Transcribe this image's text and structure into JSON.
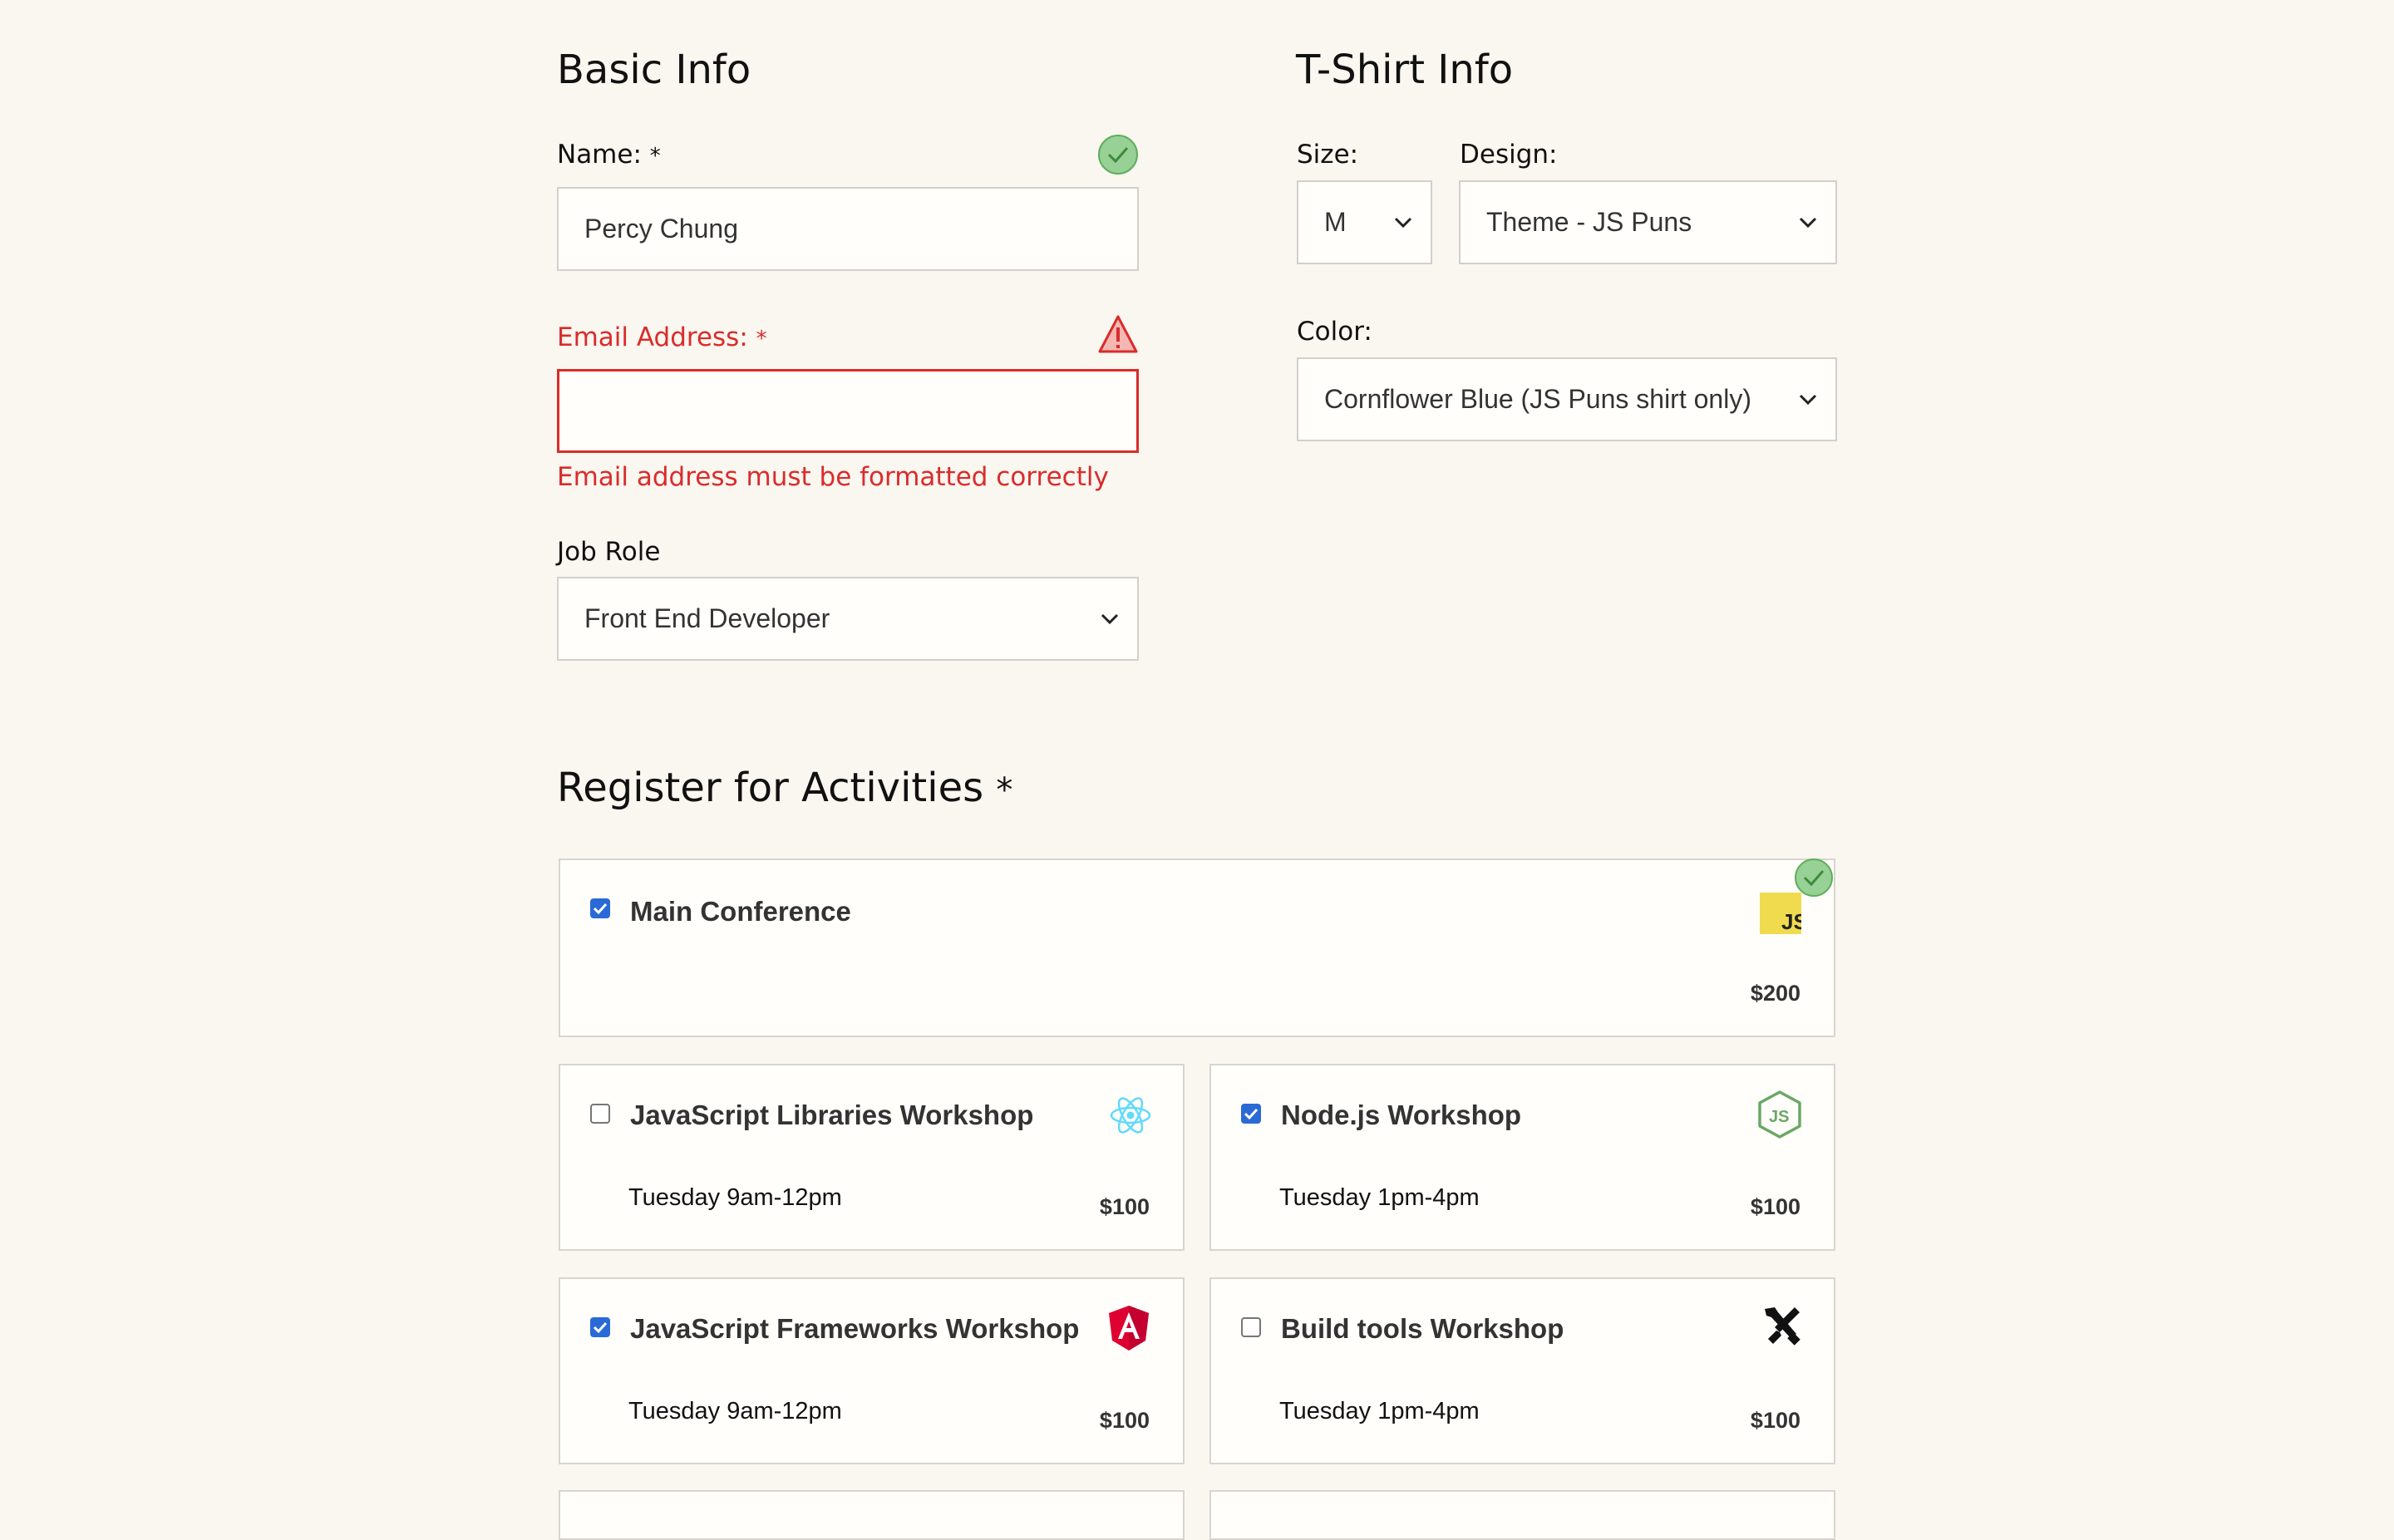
{
  "basic": {
    "heading": "Basic Info",
    "name_label": "Name:",
    "name_value": "Percy Chung",
    "email_label": "Email Address:",
    "email_value": "",
    "email_error": "Email address must be formatted correctly",
    "job_label": "Job Role",
    "job_value": "Front End Developer",
    "required_mark": "*"
  },
  "tshirt": {
    "heading": "T-Shirt Info",
    "size_label": "Size:",
    "size_value": "M",
    "design_label": "Design:",
    "design_value": "Theme - JS Puns",
    "color_label": "Color:",
    "color_value": "Cornflower Blue (JS Puns shirt only)"
  },
  "activities": {
    "heading": "Register for Activities",
    "required_mark": "*",
    "items": [
      {
        "title": "Main Conference",
        "time": "",
        "price": "$200",
        "checked": true,
        "icon": "js-icon"
      },
      {
        "title": "JavaScript Libraries Workshop",
        "time": "Tuesday 9am-12pm",
        "price": "$100",
        "checked": false,
        "icon": "react-icon"
      },
      {
        "title": "Node.js Workshop",
        "time": "Tuesday 1pm-4pm",
        "price": "$100",
        "checked": true,
        "icon": "nodejs-icon"
      },
      {
        "title": "JavaScript Frameworks Workshop",
        "time": "Tuesday 9am-12pm",
        "price": "$100",
        "checked": true,
        "icon": "angular-icon"
      },
      {
        "title": "Build tools Workshop",
        "time": "Tuesday 1pm-4pm",
        "price": "$100",
        "checked": false,
        "icon": "tools-icon"
      }
    ]
  },
  "colors": {
    "background": "#faf6f0",
    "error": "#d92c2b",
    "valid": "#97d196",
    "checkbox": "#2b6ad6"
  }
}
